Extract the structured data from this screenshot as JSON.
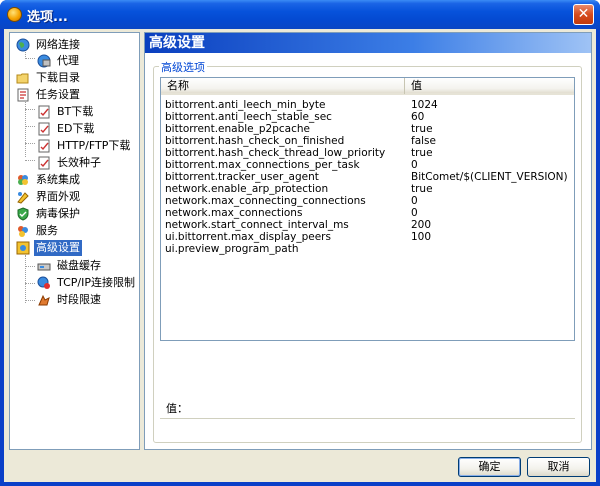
{
  "window": {
    "title": "选项..."
  },
  "nav": {
    "items": [
      {
        "label": "网络连接",
        "icon": "network-globe-icon",
        "level": 0
      },
      {
        "label": "代理",
        "icon": "proxy-globe-icon",
        "level": 1
      },
      {
        "label": "下载目录",
        "icon": "folder-icon",
        "level": 0
      },
      {
        "label": "任务设置",
        "icon": "task-settings-icon",
        "level": 0
      },
      {
        "label": "BT下载",
        "icon": "bt-download-icon",
        "level": 1
      },
      {
        "label": "ED下载",
        "icon": "ed-download-icon",
        "level": 1
      },
      {
        "label": "HTTP/FTP下载",
        "icon": "http-ftp-download-icon",
        "level": 1
      },
      {
        "label": "长效种子",
        "icon": "long-seed-icon",
        "level": 1
      },
      {
        "label": "系统集成",
        "icon": "system-integration-icon",
        "level": 0
      },
      {
        "label": "界面外观",
        "icon": "appearance-icon",
        "level": 0
      },
      {
        "label": "病毒保护",
        "icon": "shield-icon",
        "level": 0
      },
      {
        "label": "服务",
        "icon": "service-icon",
        "level": 0
      },
      {
        "label": "高级设置",
        "icon": "advanced-settings-icon",
        "level": 0,
        "selected": true
      },
      {
        "label": "磁盘缓存",
        "icon": "disk-cache-icon",
        "level": 1
      },
      {
        "label": "TCP/IP连接限制",
        "icon": "tcpip-limit-icon",
        "level": 1
      },
      {
        "label": "时段限速",
        "icon": "time-limit-icon",
        "level": 1
      }
    ]
  },
  "panel": {
    "header": "高级设置",
    "group_title": "高级选项",
    "columns": [
      "名称",
      "值"
    ],
    "rows": [
      {
        "name": "bittorrent.anti_leech_min_byte",
        "value": "1024"
      },
      {
        "name": "bittorrent.anti_leech_stable_sec",
        "value": "60"
      },
      {
        "name": "bittorrent.enable_p2pcache",
        "value": "true"
      },
      {
        "name": "bittorrent.hash_check_on_finished",
        "value": "false"
      },
      {
        "name": "bittorrent.hash_check_thread_low_priority",
        "value": "true"
      },
      {
        "name": "bittorrent.max_connections_per_task",
        "value": "0"
      },
      {
        "name": "bittorrent.tracker_user_agent",
        "value": "BitComet/$(CLIENT_VERSION)"
      },
      {
        "name": "network.enable_arp_protection",
        "value": "true"
      },
      {
        "name": "network.max_connecting_connections",
        "value": "0"
      },
      {
        "name": "network.max_connections",
        "value": "0"
      },
      {
        "name": "network.start_connect_interval_ms",
        "value": "200"
      },
      {
        "name": "ui.bittorrent.max_display_peers",
        "value": "100"
      },
      {
        "name": "ui.preview_program_path",
        "value": ""
      }
    ],
    "value_label": "值："
  },
  "buttons": {
    "ok": "确定",
    "cancel": "取消"
  },
  "colors": {
    "selection": "#316ac5",
    "title_blue": "#0449d1",
    "group_title": "#0046d5"
  }
}
